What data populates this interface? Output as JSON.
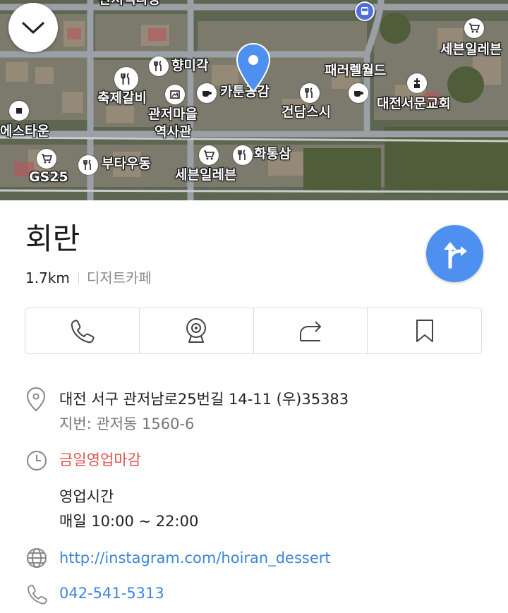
{
  "map": {
    "collapse_icon": "chevron-down-icon",
    "poi_labels": {
      "top_cut": "관저떡다방",
      "hyangmigak": "향미각",
      "festival_galbi": "축제갈비",
      "kafun": "카툰공감",
      "parallel_world": "패러렐월드",
      "seven_eleven_top": "세븐일레븐",
      "daejeon_church": "대전서문교회",
      "geondam_sushi": "건담스시",
      "gwanjeo_history_1": "관저마을",
      "gwanjeo_history_2": "역사관",
      "estown": "에스타운",
      "hwatongsam": "화통삼",
      "butaudong": "부타우동",
      "seven_eleven_bottom": "세븐일레븐",
      "gs25": "GS25"
    },
    "pin_color": "#4d90f0"
  },
  "place": {
    "name": "회란",
    "distance": "1.7km",
    "category": "디저트카페"
  },
  "directions_icon": "directions-turn-icon",
  "actions": [
    {
      "icon": "phone-icon"
    },
    {
      "icon": "webcam-icon"
    },
    {
      "icon": "share-icon"
    },
    {
      "icon": "bookmark-icon"
    }
  ],
  "info": {
    "address": "대전 서구 관저남로25번길 14-11 (우)35383",
    "lot_address": "지번: 관저동 1560-6",
    "status": "금일영업마감",
    "hours_title": "영업시간",
    "hours": "매일 10:00 ~ 22:00",
    "website": "http://instagram.com/hoiran_dessert",
    "phone": "042-541-5313"
  },
  "colors": {
    "accent_blue": "#4d90f0",
    "status_red": "#e0534d",
    "link_blue": "#3c86d8"
  }
}
